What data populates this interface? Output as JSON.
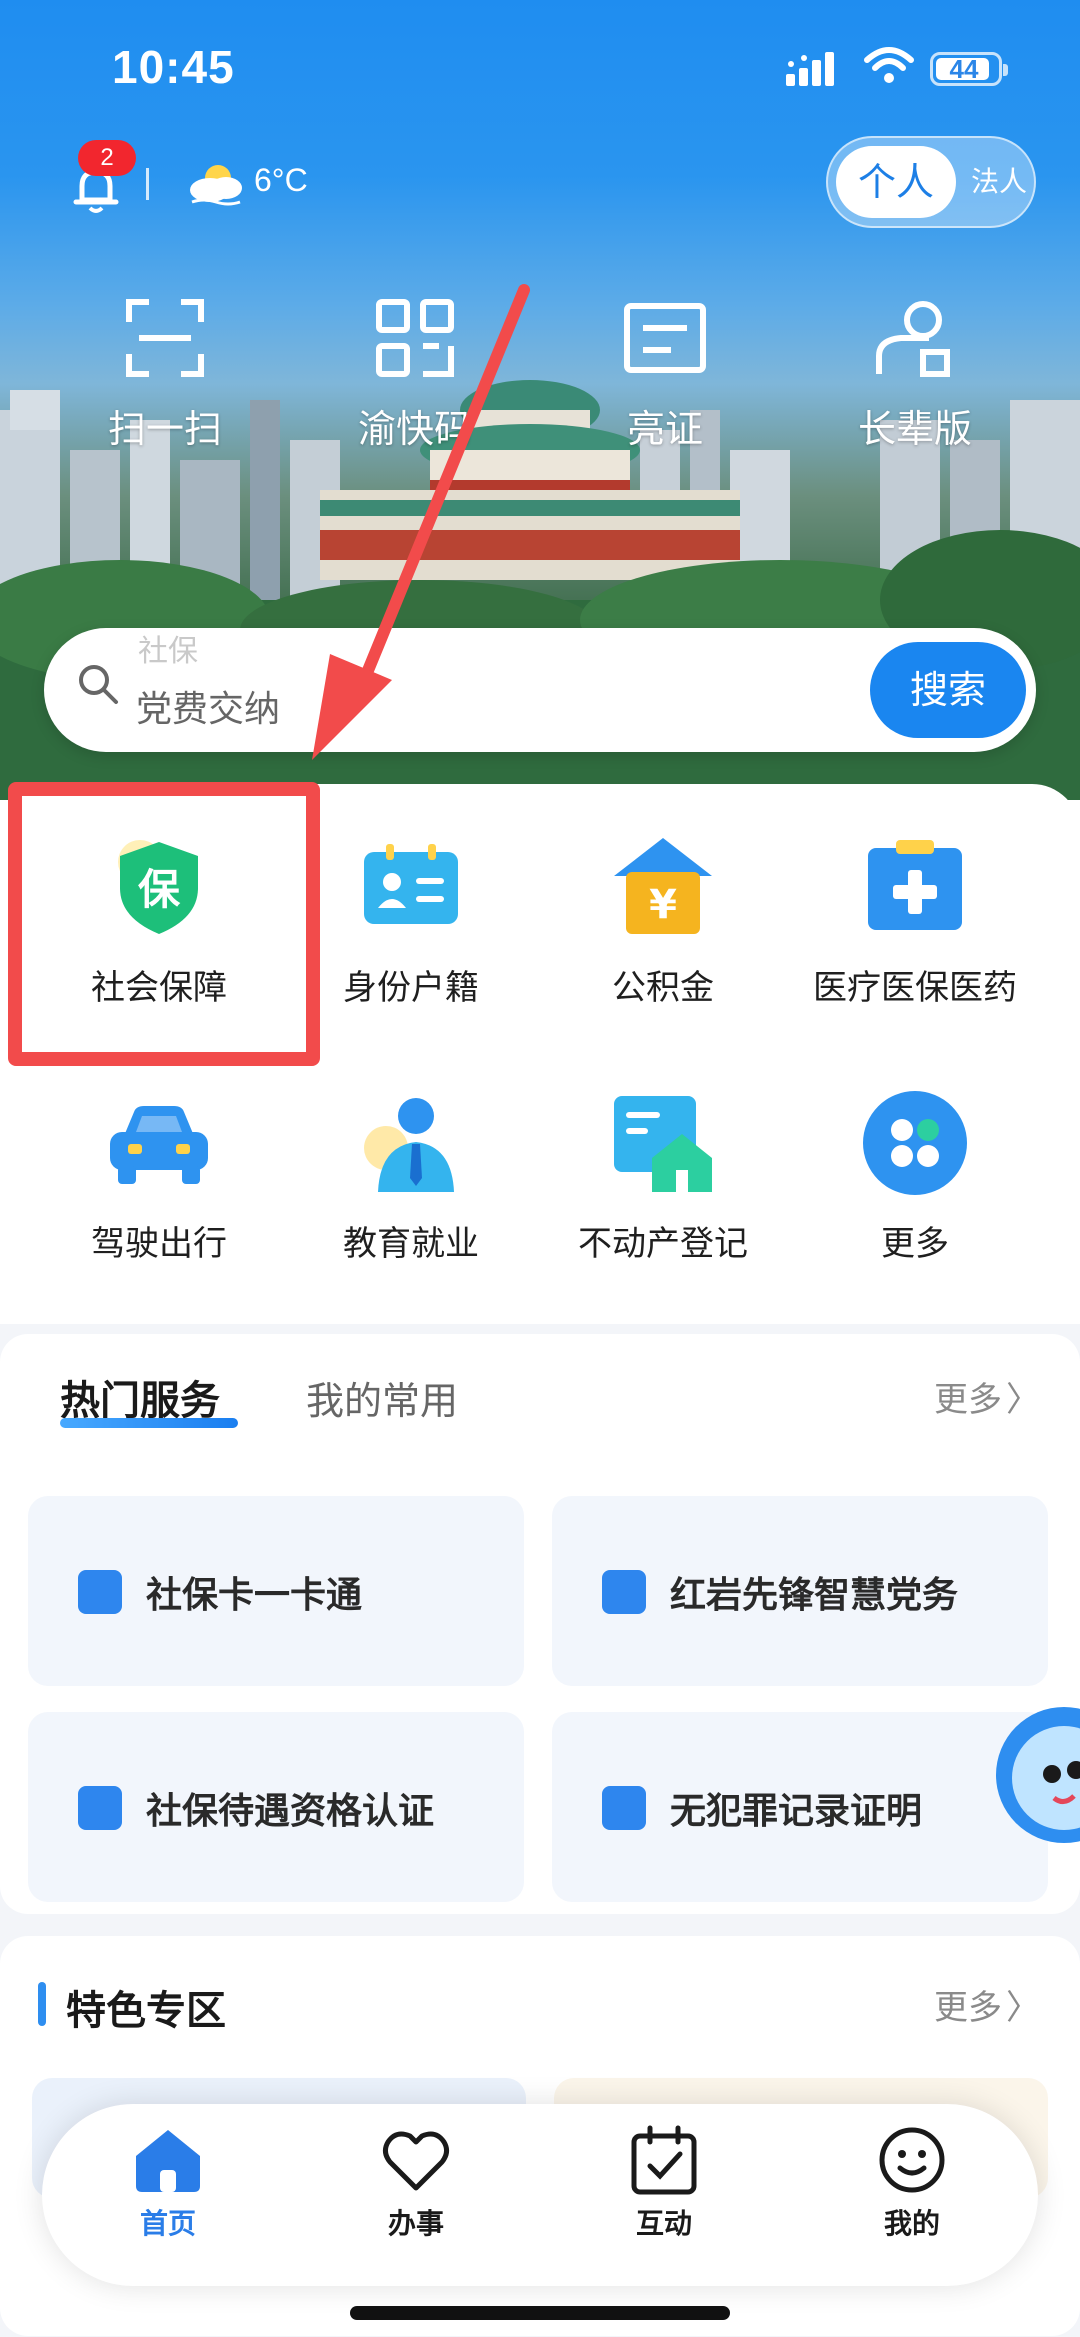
{
  "status_bar": {
    "time": "10:45",
    "battery": "44"
  },
  "header": {
    "notification_count": "2",
    "temperature": "6°C",
    "role_active": "个人",
    "role_inactive": "法人"
  },
  "quick_actions": [
    {
      "label": "扫一扫",
      "icon": "scan-icon"
    },
    {
      "label": "渝快码",
      "icon": "qr-code-icon"
    },
    {
      "label": "亮证",
      "icon": "id-card-icon"
    },
    {
      "label": "长辈版",
      "icon": "elder-icon"
    }
  ],
  "search": {
    "hint": "社保",
    "placeholder": "党费交纳",
    "button": "搜索"
  },
  "services_grid": [
    {
      "label": "社会保障",
      "icon": "shield-bao-icon",
      "color": "#1dbf7a"
    },
    {
      "label": "身份户籍",
      "icon": "id-badge-icon",
      "color": "#34b4ee"
    },
    {
      "label": "公积金",
      "icon": "house-yen-icon",
      "color": "#f5b41f"
    },
    {
      "label": "医疗医保医药",
      "icon": "medical-plus-icon",
      "color": "#2e93f0"
    },
    {
      "label": "驾驶出行",
      "icon": "car-icon",
      "color": "#2e93f0"
    },
    {
      "label": "教育就业",
      "icon": "person-tie-icon",
      "color": "#34b4ee"
    },
    {
      "label": "不动产登记",
      "icon": "property-icon",
      "color": "#2ccfa0"
    },
    {
      "label": "更多",
      "icon": "more-grid-icon",
      "color": "#2e93f0"
    }
  ],
  "hot_services": {
    "tab_active": "热门服务",
    "tab_inactive": "我的常用",
    "more": "更多",
    "items": [
      {
        "label": "社保卡一卡通"
      },
      {
        "label": "红岩先锋智慧党务"
      },
      {
        "label": "社保待遇资格认证"
      },
      {
        "label": "无犯罪记录证明"
      }
    ]
  },
  "featured": {
    "title": "特色专区",
    "more": "更多"
  },
  "bottom_nav": [
    {
      "label": "首页",
      "active": true
    },
    {
      "label": "办事",
      "active": false
    },
    {
      "label": "互动",
      "active": false
    },
    {
      "label": "我的",
      "active": false
    }
  ]
}
